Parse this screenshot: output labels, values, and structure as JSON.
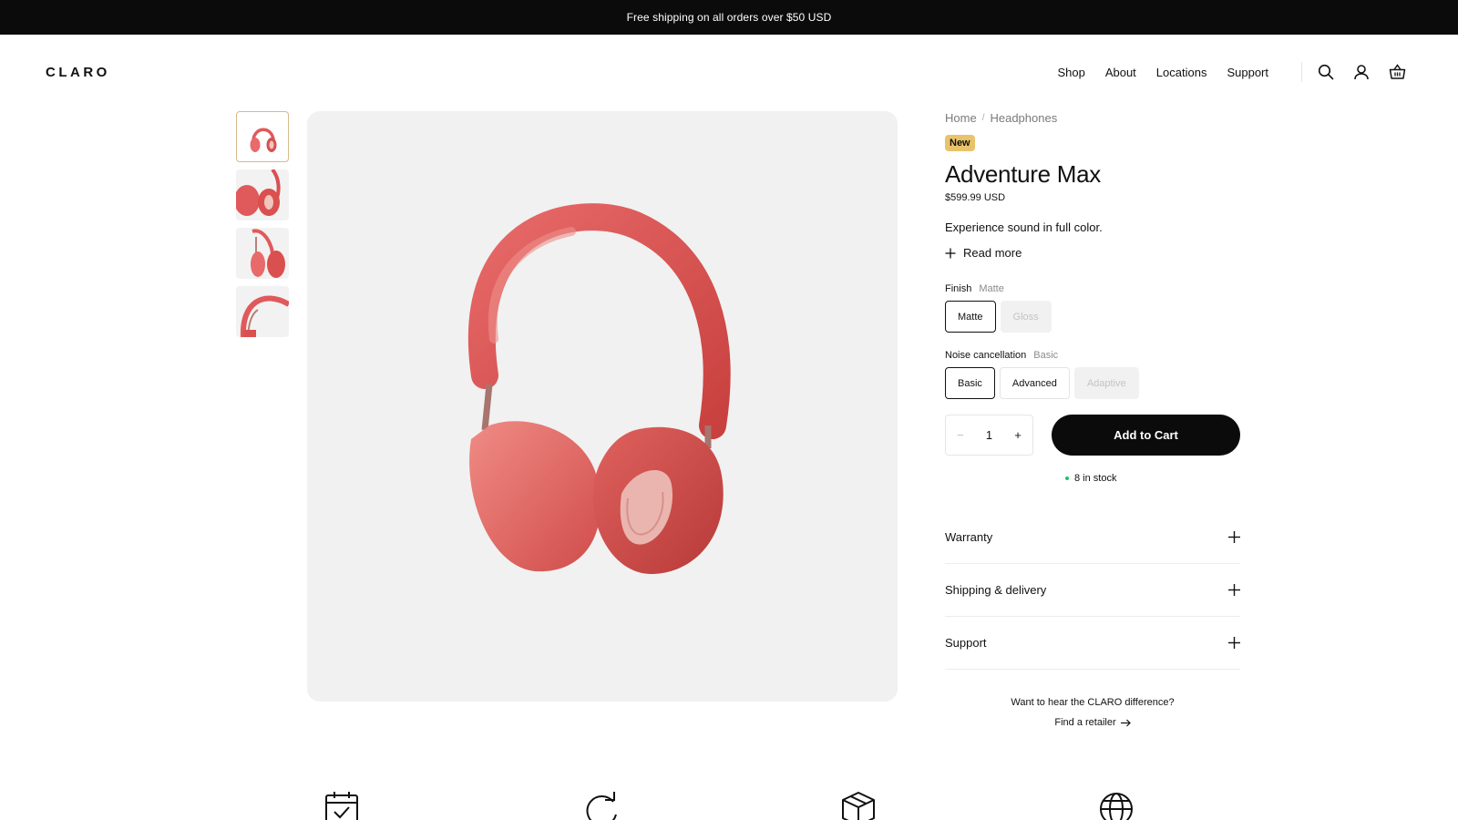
{
  "announcement": {
    "text": "Free shipping on all orders over $50 USD"
  },
  "header": {
    "logo": "CLARO",
    "nav": [
      "Shop",
      "About",
      "Locations",
      "Support"
    ],
    "icons": [
      "search-icon",
      "account-icon",
      "cart-icon"
    ]
  },
  "gallery": {
    "thumbnails": [
      "front-view",
      "ear-cup-view",
      "side-view",
      "headband-view"
    ],
    "active_index": 0
  },
  "product": {
    "breadcrumb": [
      "Home",
      "Headphones"
    ],
    "badge": "New",
    "title": "Adventure Max",
    "price": "$599.99 USD",
    "tagline": "Experience sound in full color.",
    "read_more": "Read more",
    "finish": {
      "label": "Finish",
      "selected": "Matte",
      "options": [
        "Matte",
        "Gloss"
      ]
    },
    "noise": {
      "label": "Noise cancellation",
      "selected": "Basic",
      "options": [
        "Basic",
        "Advanced",
        "Adaptive"
      ]
    },
    "quantity": "1",
    "add_to_cart": "Add to Cart",
    "stock": "8 in stock",
    "accordion": [
      "Warranty",
      "Shipping & delivery",
      "Support"
    ],
    "retailer_prompt": "Want to hear the CLARO difference?",
    "retailer_link": "Find a retailer"
  },
  "features": {
    "icons": [
      "calendar-check-icon",
      "refresh-icon",
      "package-icon",
      "globe-icon"
    ]
  },
  "colors": {
    "accent_badge": "#e8c36b",
    "headphone_red": "#e0595b",
    "stock_green": "#1fbf6b"
  }
}
